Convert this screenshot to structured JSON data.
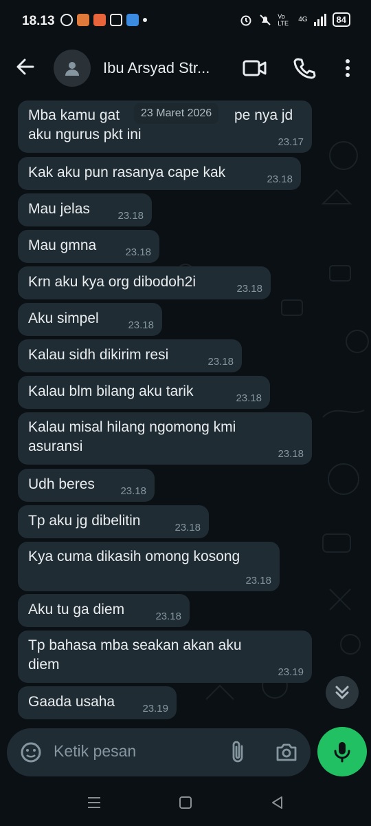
{
  "status_bar": {
    "time": "18.13",
    "volte": "Vo LTE",
    "network": "4G",
    "battery": "84"
  },
  "header": {
    "contact_name": "Ibu Arsyad Str..."
  },
  "chat": {
    "date_chip": "23 Maret 2026",
    "messages": [
      {
        "line1": "Mba kamu gat",
        "line1b": "pe nya jd",
        "line2": "aku ngurus pkt ini",
        "time": "23.17"
      },
      {
        "line1": "Kak aku pun rasanya cape kak",
        "time": "23.18"
      },
      {
        "line1": "Mau jelas",
        "time": "23.18"
      },
      {
        "line1": "Mau gmna",
        "time": "23.18"
      },
      {
        "line1": "Krn aku kya org dibodoh2i",
        "time": "23.18"
      },
      {
        "line1": "Aku simpel",
        "time": "23.18"
      },
      {
        "line1": "Kalau sidh dikirim resi",
        "time": "23.18"
      },
      {
        "line1": "Kalau blm bilang aku tarik",
        "time": "23.18"
      },
      {
        "line1": "Kalau misal hilang ngomong kmi",
        "line2": "asuransi",
        "time": "23.18"
      },
      {
        "line1": "Udh beres",
        "time": "23.18"
      },
      {
        "line1": "Tp aku jg dibelitin",
        "time": "23.18"
      },
      {
        "line1": "Kya cuma dikasih omong kosong",
        "time": "23.18"
      },
      {
        "line1": "Aku tu ga diem",
        "time": "23.18"
      },
      {
        "line1": "Tp bahasa mba seakan akan aku",
        "line2": "diem",
        "time": "23.19"
      },
      {
        "line1": "Gaada usaha",
        "time": "23.19"
      }
    ]
  },
  "composer": {
    "placeholder": "Ketik pesan"
  },
  "colors": {
    "bubble": "#202c33",
    "background": "#0b1014",
    "mic_button": "#21c063",
    "timestamp": "#8696a0"
  }
}
